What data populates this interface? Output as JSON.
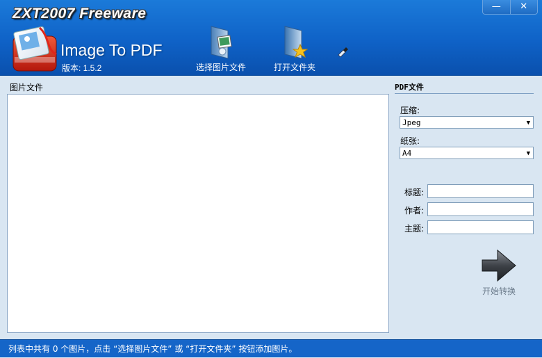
{
  "header": {
    "app_title": "ZXT2007 Freeware",
    "app_name": "Image To PDF",
    "version": "版本: 1.5.2",
    "window_controls": {
      "minimize": "—",
      "close": "✕"
    },
    "toolbar": {
      "select_images": "选择图片文件",
      "open_folder": "打开文件夹"
    }
  },
  "left_panel": {
    "title": "图片文件"
  },
  "right_panel": {
    "title": "PDF文件",
    "compression_label": "压缩:",
    "compression_value": "Jpeg",
    "paper_label": "纸张:",
    "paper_value": "A4",
    "title_label": "标题:",
    "author_label": "作者:",
    "subject_label": "主题:",
    "title_value": "",
    "author_value": "",
    "subject_value": "",
    "convert_label": "开始转换"
  },
  "status_bar": {
    "text": "列表中共有 0 个图片，点击 “选择图片文件” 或 “打开文件夹” 按钮添加图片。"
  },
  "colors": {
    "header_blue": "#1b7ad9",
    "status_blue": "#1565c8",
    "panel_bg": "#d9e6f2"
  }
}
